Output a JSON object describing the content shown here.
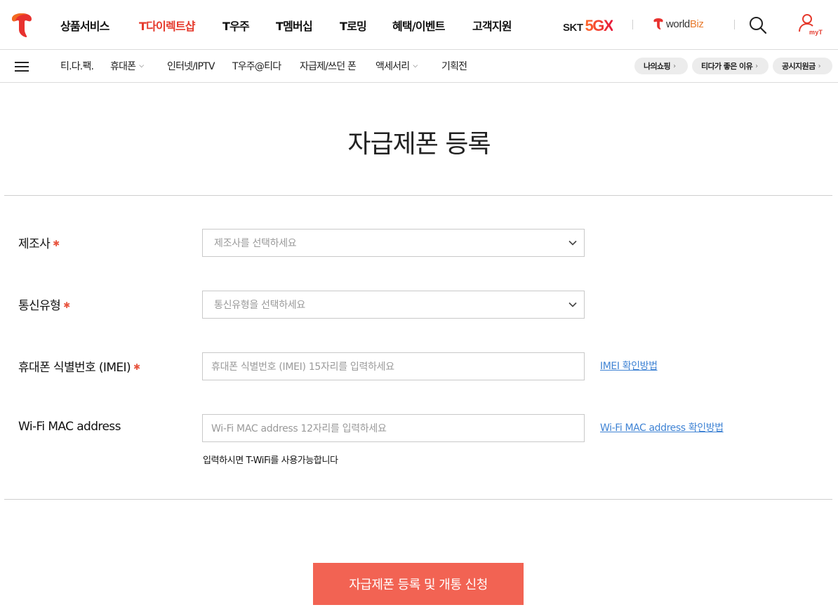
{
  "header": {
    "logo_icon": "t-logo-icon",
    "nav": [
      "상품서비스",
      "T다이렉트샵",
      "T우주",
      "T멤버십",
      "T로밍",
      "혜택/이벤트",
      "고객지원"
    ],
    "active_nav": "T다이렉트샵",
    "brand_skt": "SKT",
    "brand_5gx": "5GX",
    "worldbiz_world": "world",
    "worldbiz_biz": "Biz",
    "search_icon": "search-icon",
    "myt_label": "myT"
  },
  "subnav": {
    "menu_icon": "hamburger-menu-icon",
    "items": [
      {
        "label": "티.다.팩.",
        "has_dropdown": false
      },
      {
        "label": "휴대폰",
        "has_dropdown": true
      },
      {
        "label": "인터넷/IPTV",
        "has_dropdown": false
      },
      {
        "label": "T우주@티다",
        "has_dropdown": false
      },
      {
        "label": "자급제/쓰던 폰",
        "has_dropdown": false
      },
      {
        "label": "액세서리",
        "has_dropdown": true
      },
      {
        "label": "기획전",
        "has_dropdown": false
      }
    ],
    "quick_links": [
      "나의쇼핑",
      "티다가 좋은 이유",
      "공시지원금"
    ]
  },
  "page": {
    "title": "자급제폰 등록",
    "form": {
      "manufacturer": {
        "label": "제조사",
        "required": true,
        "placeholder": "제조사를 선택하세요"
      },
      "carrier_type": {
        "label": "통신유형",
        "required": true,
        "placeholder": "통신유형을 선택하세요"
      },
      "imei": {
        "label": "휴대폰 식별번호 (IMEI)",
        "required": true,
        "placeholder": "휴대폰 식별번호 (IMEI) 15자리를 입력하세요",
        "help_link": "IMEI 확인방법"
      },
      "wifi_mac": {
        "label": "Wi-Fi MAC address",
        "required": false,
        "placeholder": "Wi-Fi MAC address 12자리를 입력하세요",
        "help_link": "Wi-Fi MAC address 확인방법",
        "hint": "입력하시면 T-WiFi를 사용가능합니다"
      }
    },
    "submit_label": "자급제폰 등록 및 개통 신청"
  },
  "colors": {
    "brand_red": "#e53a2d",
    "submit_bg": "#f26353",
    "link_blue": "#3f83d4",
    "required_mark": "#e8553f"
  }
}
